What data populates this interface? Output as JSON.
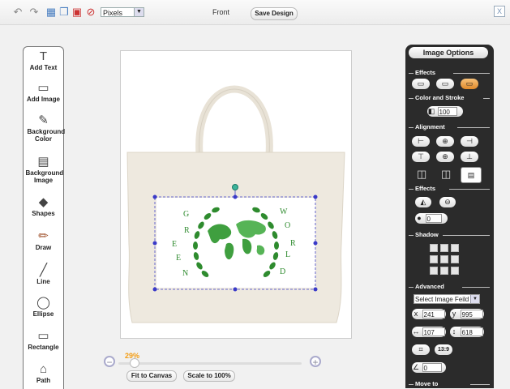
{
  "toolbar": {
    "units_value": "Pixels",
    "side_label": "Front",
    "save_label": "Save Design",
    "close_label": "X"
  },
  "tools": [
    {
      "label": "Add Text",
      "icon": "T"
    },
    {
      "label": "Add Image",
      "icon": "▭"
    },
    {
      "label": "Background Color",
      "icon": "✎"
    },
    {
      "label": "Background Image",
      "icon": "▤"
    },
    {
      "label": "Shapes",
      "icon": "◆"
    },
    {
      "label": "Draw",
      "icon": "✏"
    },
    {
      "label": "Line",
      "icon": "╱"
    },
    {
      "label": "Ellipse",
      "icon": "◯"
    },
    {
      "label": "Rectangle",
      "icon": "▭"
    },
    {
      "label": "Path",
      "icon": "⌂"
    }
  ],
  "canvas": {
    "design_letters_left": [
      "G",
      "R",
      "E",
      "E",
      "N"
    ],
    "design_letters_right": [
      "W",
      "O",
      "R",
      "L",
      "D"
    ]
  },
  "zoom": {
    "percent": "29%",
    "level": 0.29,
    "fit_label": "Fit to Canvas",
    "scale_label": "Scale to 100%"
  },
  "panel": {
    "title": "Image Options",
    "sections": {
      "effects": "Effects",
      "color_stroke": "Color and Stroke",
      "alignment": "Alignment",
      "effects2": "Effects",
      "shadow": "Shadow",
      "advanced": "Advanced",
      "move_to": "Move to"
    },
    "opacity_value": "100",
    "effect_value": "0",
    "select_field": "Select Image Feild",
    "x_label": "x",
    "x_value": "241",
    "y_label": "y",
    "y_value": "995",
    "w_value": "107",
    "h_value": "618",
    "lock_label": "13:9",
    "angle_value": "0"
  },
  "colors": {
    "accent": "#f39c12",
    "panel_bg": "#2b2b2b",
    "design_green": "#2e8b2e",
    "selection_blue": "#3a3ac8"
  }
}
